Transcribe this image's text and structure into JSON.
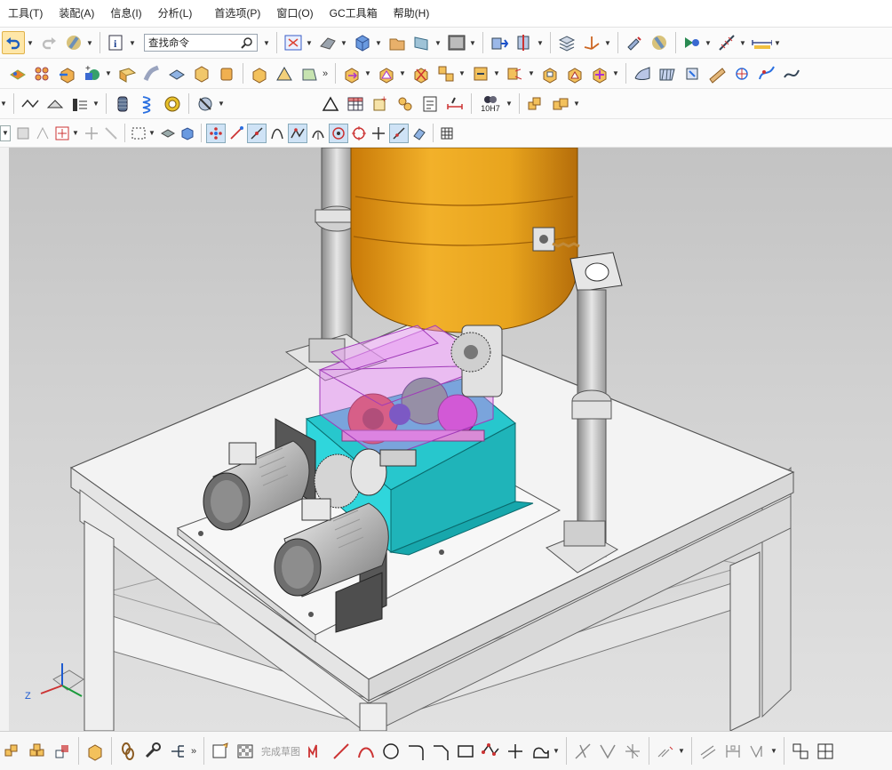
{
  "menu": [
    {
      "id": "tools",
      "label": "工具(T)"
    },
    {
      "id": "assembly",
      "label": "装配(A)"
    },
    {
      "id": "info",
      "label": "信息(I)"
    },
    {
      "id": "analysis",
      "label": "分析(L)"
    },
    {
      "id": "preferences",
      "label": "首选项(P)"
    },
    {
      "id": "window",
      "label": "窗口(O)"
    },
    {
      "id": "gc-toolbox",
      "label": "GC工具箱"
    },
    {
      "id": "help",
      "label": "帮助(H)"
    }
  ],
  "toolbar": {
    "find_command_placeholder": "查找命令",
    "tolerance_label": "10H7",
    "finish_sketch_label": "完成草图"
  },
  "colors": {
    "accent": "#f5a623",
    "tank": "#e9a21c",
    "gearbox": "#21c9cf",
    "cover": "#e07bf0",
    "gear": "#d9503a",
    "table": "#f1f1f1"
  },
  "viewport": {
    "axis_label": "Z"
  }
}
